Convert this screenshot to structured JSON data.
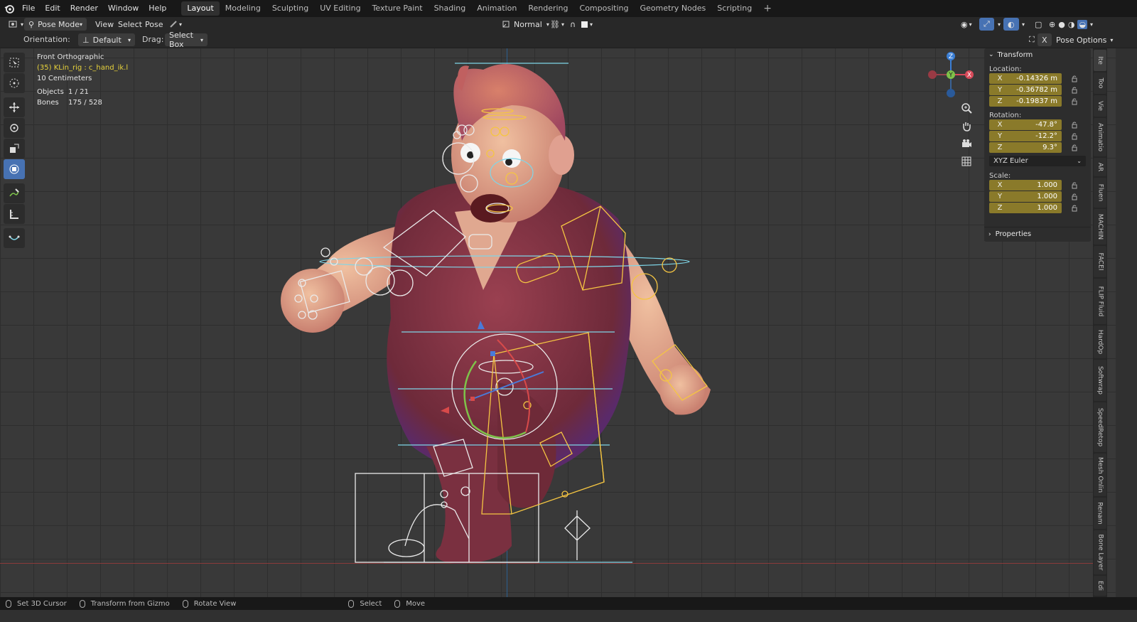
{
  "menu": [
    "File",
    "Edit",
    "Render",
    "Window",
    "Help"
  ],
  "workspaces": [
    "Layout",
    "Modeling",
    "Sculpting",
    "UV Editing",
    "Texture Paint",
    "Shading",
    "Animation",
    "Rendering",
    "Compositing",
    "Geometry Nodes",
    "Scripting"
  ],
  "active_workspace": "Layout",
  "header": {
    "mode": "Pose Mode",
    "menus": [
      "View",
      "Select",
      "Pose"
    ],
    "shading_mode": "Normal",
    "pose_options": "Pose Options"
  },
  "tool_settings": {
    "orientation_label": "Orientation:",
    "orientation_value": "Default",
    "drag_label": "Drag:",
    "drag_value": "Select Box"
  },
  "viewport_info": {
    "view_name": "Front Orthographic",
    "active": "(35) KLin_rig : c_hand_ik.l",
    "scale": "10 Centimeters",
    "objects_label": "Objects",
    "objects_value": "1 / 21",
    "bones_label": "Bones",
    "bones_value": "175 / 528"
  },
  "gizmo": {
    "z": "Z",
    "y": "Y",
    "x": "X"
  },
  "transform_panel": {
    "title": "Transform",
    "location_label": "Location:",
    "location": [
      {
        "axis": "X",
        "value": "-0.14326 m"
      },
      {
        "axis": "Y",
        "value": "-0.36782 m"
      },
      {
        "axis": "Z",
        "value": "-0.19837 m"
      }
    ],
    "rotation_label": "Rotation:",
    "rotation": [
      {
        "axis": "X",
        "value": "-47.8°"
      },
      {
        "axis": "Y",
        "value": "-12.2°"
      },
      {
        "axis": "Z",
        "value": "9.3°"
      }
    ],
    "rotation_mode": "XYZ Euler",
    "scale_label": "Scale:",
    "scale": [
      {
        "axis": "X",
        "value": "1.000"
      },
      {
        "axis": "Y",
        "value": "1.000"
      },
      {
        "axis": "Z",
        "value": "1.000"
      }
    ],
    "properties": "Properties"
  },
  "side_tabs": [
    "Ite",
    "Too",
    "Vie",
    "Animatio",
    "AR",
    "Fluen",
    "MACHIN",
    "FACEI",
    "FLIP Fluid",
    "HardOp",
    "Softwrap",
    "SpeedRetop",
    "Mesh Onlin",
    "Renam",
    "Bone Layer",
    "Edi"
  ],
  "status_bar": [
    {
      "label": "Set 3D Cursor"
    },
    {
      "label": "Transform from Gizmo"
    },
    {
      "label": "Rotate View"
    },
    {
      "label": "Select"
    },
    {
      "label": "Move"
    }
  ],
  "colors": {
    "accent": "#4772b3",
    "field": "#8a7a2a",
    "bone_selected": "#f5c542",
    "bone": "#e8e8e8",
    "bone_cyan": "#7fd6e8",
    "character": "#8e3a48",
    "skin": "#e0a98a"
  }
}
